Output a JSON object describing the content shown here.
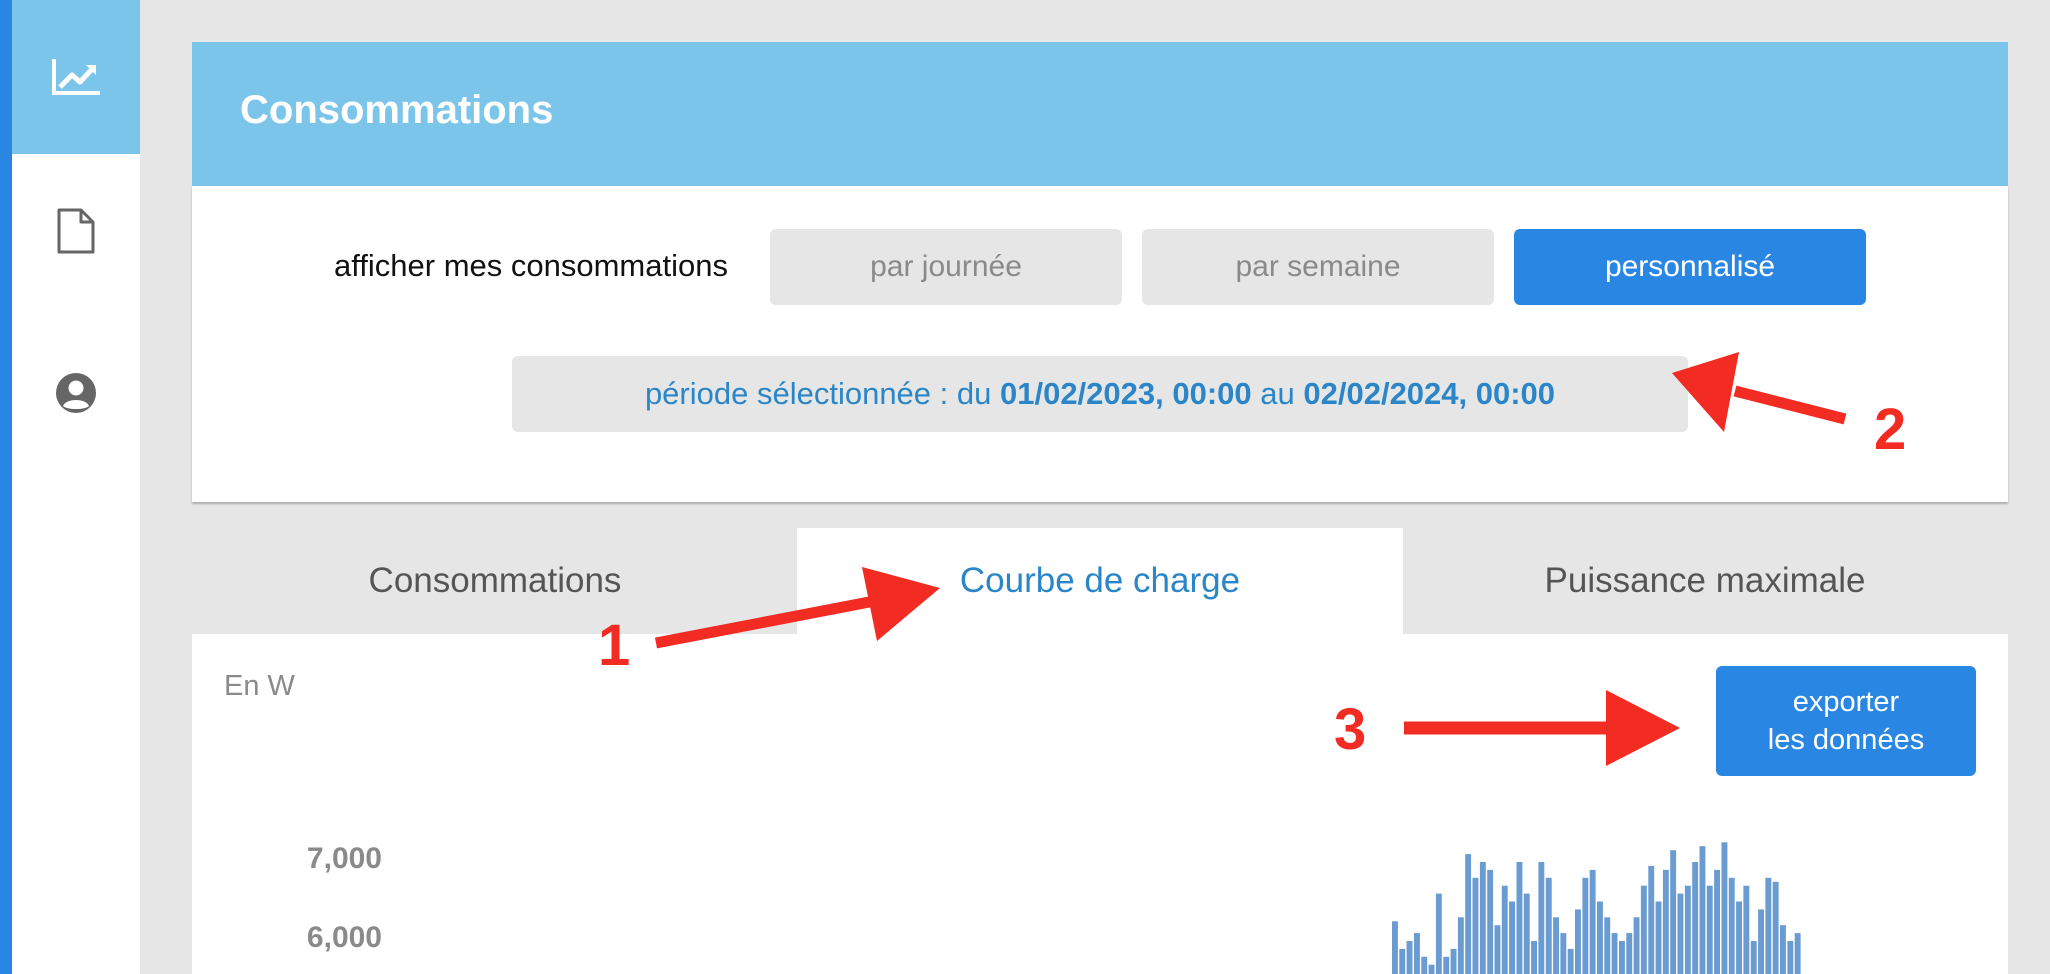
{
  "sidebar": {
    "items": [
      {
        "icon": "chart-line-icon",
        "active": true
      },
      {
        "icon": "document-icon",
        "active": false
      },
      {
        "icon": "user-circle-icon",
        "active": false
      }
    ]
  },
  "panel": {
    "title": "Consommations",
    "filter_label": "afficher mes consommations",
    "buttons": [
      {
        "label": "par journée",
        "active": false
      },
      {
        "label": "par semaine",
        "active": false
      },
      {
        "label": "personnalisé",
        "active": true
      }
    ],
    "period": {
      "prefix": "période sélectionnée : du ",
      "start": "01/02/2023, 00:00",
      "middle": " au ",
      "end": "02/02/2024, 00:00"
    }
  },
  "tabs": [
    {
      "label": "Consommations",
      "active": false
    },
    {
      "label": "Courbe de charge",
      "active": true
    },
    {
      "label": "Puissance maximale",
      "active": false
    }
  ],
  "chart": {
    "unit_label": "En W",
    "export_line1": "exporter",
    "export_line2": "les données",
    "y_ticks": [
      "7,000",
      "6,000"
    ]
  },
  "chart_data": {
    "type": "bar",
    "ylabel": "En W",
    "y_visible_range": [
      5400,
      7450
    ],
    "bar_color": "#6a9bd1",
    "values": [
      6250,
      5900,
      6000,
      6100,
      5800,
      5700,
      6600,
      5800,
      5900,
      6300,
      7100,
      6800,
      7000,
      6900,
      6200,
      6700,
      6500,
      7000,
      6600,
      6000,
      7000,
      6800,
      6300,
      6100,
      5900,
      6400,
      6800,
      6900,
      6500,
      6300,
      6100,
      6000,
      6100,
      6300,
      6700,
      6950,
      6500,
      6900,
      7150,
      6600,
      6700,
      7000,
      7200,
      6700,
      6900,
      7250,
      6800,
      6500,
      6700,
      6000,
      6400,
      6800,
      6750,
      6200,
      6000,
      6100
    ]
  },
  "annotations": {
    "color": "#f22b23",
    "labels": [
      "1",
      "2",
      "3"
    ]
  }
}
